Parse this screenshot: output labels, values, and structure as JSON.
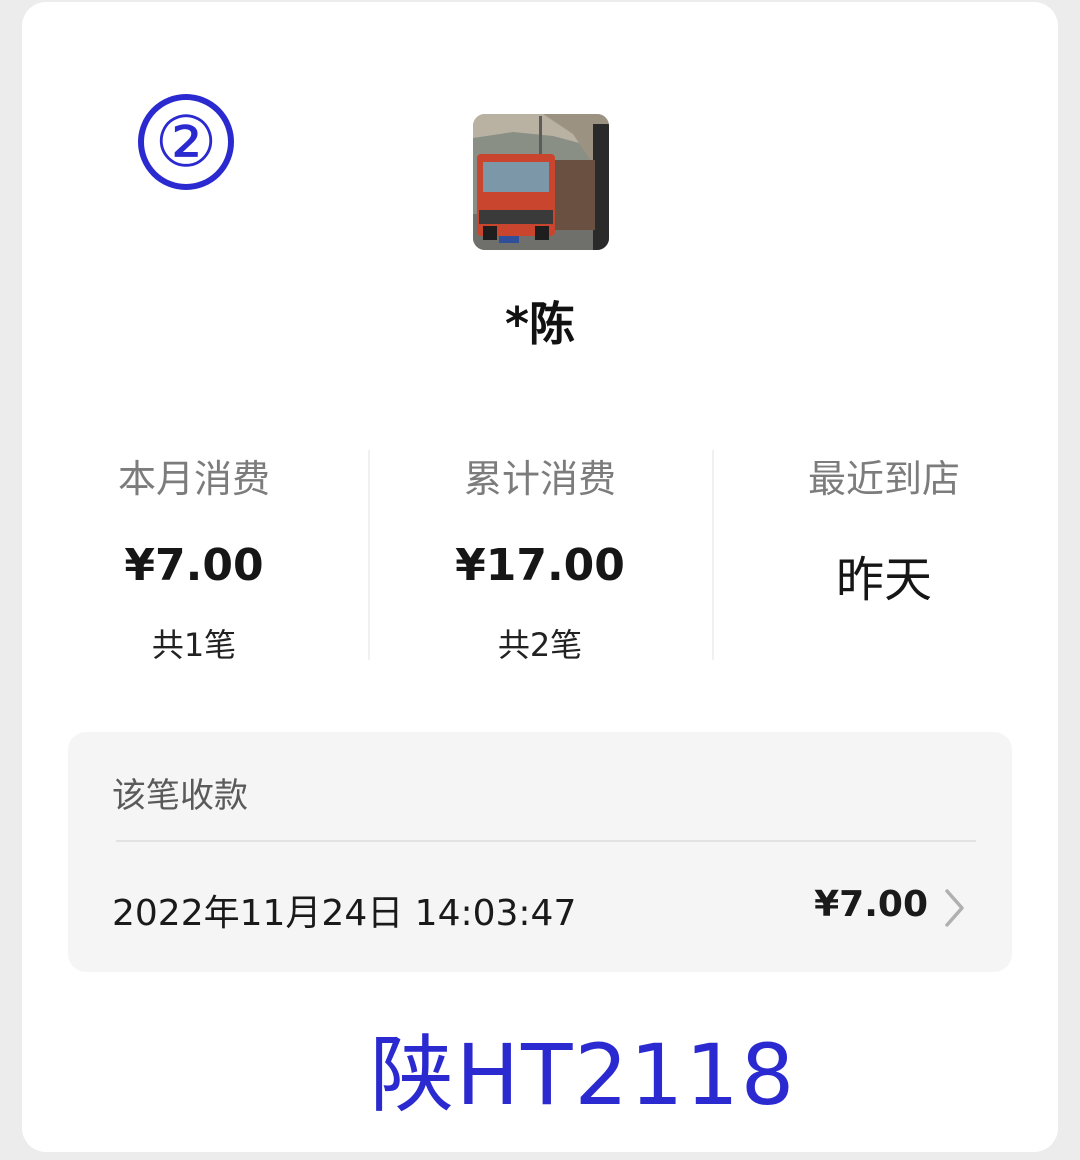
{
  "badge_number": "②",
  "customer": {
    "avatar_icon": "red-truck-photo",
    "name": "*陈"
  },
  "stats": [
    {
      "label": "本月消费",
      "value": "¥7.00",
      "sub": "共1笔"
    },
    {
      "label": "累计消费",
      "value": "¥17.00",
      "sub": "共2笔"
    },
    {
      "label": "最近到店",
      "value": "昨天",
      "sub": ""
    }
  ],
  "payment": {
    "title": "该笔收款",
    "datetime": "2022年11月24日 14:03:47",
    "amount": "¥7.00",
    "chevron_icon": "chevron-right-icon"
  },
  "plate_annotation": "陕HT2118",
  "colors": {
    "annotation": "#2a2ad0",
    "panel_bg": "#f5f5f5",
    "label_gray": "#7c7c7c"
  }
}
